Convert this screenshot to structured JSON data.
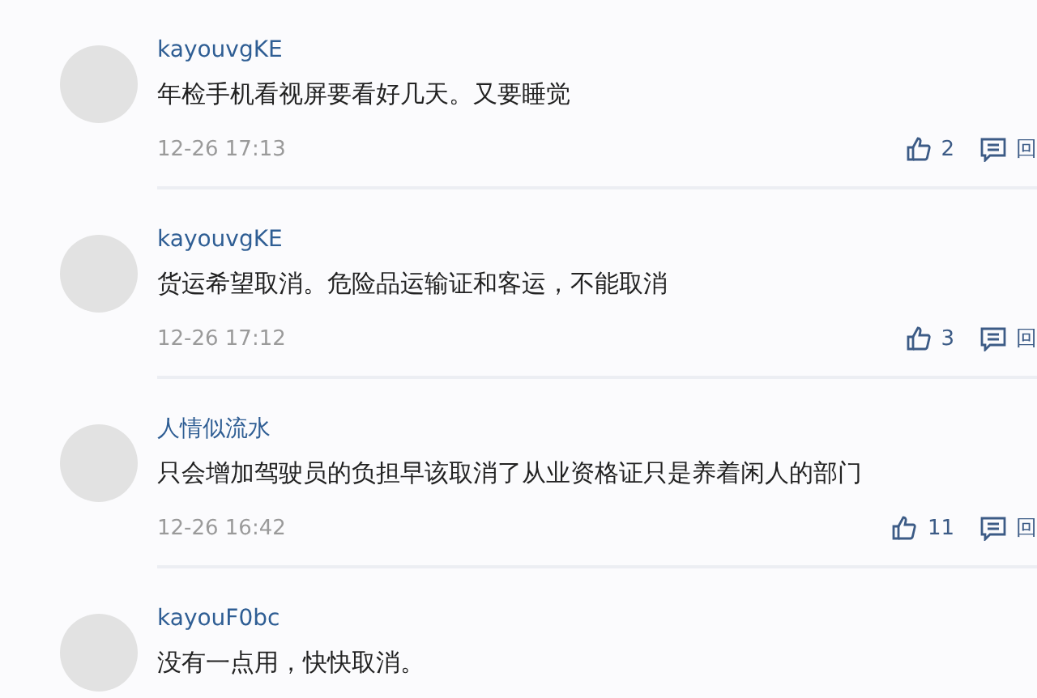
{
  "comments": [
    {
      "user": "kayouvgKE",
      "text": "年检手机看视屏要看好几天。又要睡觉",
      "time": "12-26 17:13",
      "likes": "2",
      "reply": "回"
    },
    {
      "user": "kayouvgKE",
      "text": "货运希望取消。危险品运输证和客运，不能取消",
      "time": "12-26 17:12",
      "likes": "3",
      "reply": "回"
    },
    {
      "user": "人情似流水",
      "text": "只会增加驾驶员的负担早该取消了从业资格证只是养着闲人的部门",
      "time": "12-26 16:42",
      "likes": "11",
      "reply": "回"
    },
    {
      "user": "kayouF0bc",
      "text": "没有一点用，快快取消。"
    }
  ]
}
